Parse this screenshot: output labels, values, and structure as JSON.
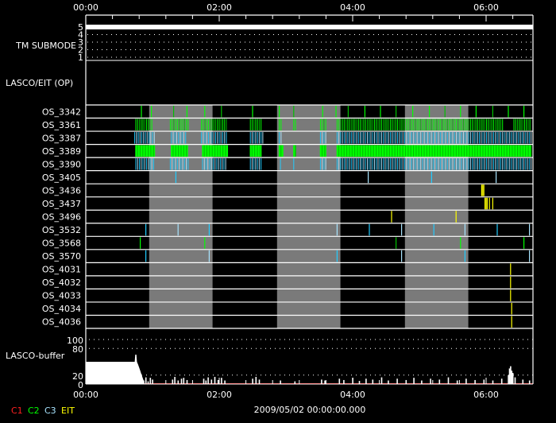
{
  "chart_data": {
    "type": "timeline",
    "title": "LASCO/EIT observation timeline",
    "time_unit": "minutes since 00:00",
    "xlim": [
      0,
      402
    ],
    "x_tick_labels": [
      "00:00",
      "02:00",
      "04:00",
      "06:00"
    ],
    "x_tick_minutes": [
      0,
      120,
      240,
      360
    ],
    "date_label": "2009/05/02 00:00:00.000",
    "colors": {
      "C1": "#ff2020",
      "C2": "#00ff00",
      "C3": "#22ccff",
      "C3b": "#a8e4ff",
      "EIT": "#ffff00",
      "gray": "#7a7a7a"
    },
    "legend": [
      {
        "label": "C1",
        "color": "#ff2020"
      },
      {
        "label": "C2",
        "color": "#00ff00"
      },
      {
        "label": "C3",
        "color": "#a8e4ff"
      },
      {
        "label": "EIT",
        "color": "#ffff00"
      }
    ],
    "tm_submode": {
      "label": "TM SUBMODE",
      "levels": [
        "5",
        "4",
        "3",
        "2",
        "1"
      ],
      "value": 5
    },
    "lasco_eit_op": {
      "label": "LASCO/EIT (OP)"
    },
    "gray_intervals": [
      [
        57,
        114
      ],
      [
        172,
        229
      ],
      [
        287,
        344
      ]
    ],
    "rows": [
      {
        "label": "OS_3342",
        "color": "C2",
        "events": [
          50,
          59,
          79,
          91,
          107,
          122,
          150,
          174,
          187,
          213,
          225,
          236,
          251,
          265,
          279,
          294,
          309,
          323,
          337,
          351,
          366,
          380,
          394
        ]
      },
      {
        "label": "OS_3361",
        "color": "C2",
        "clusters": [
          [
            45,
            61
          ],
          [
            76,
            92
          ],
          [
            104,
            127
          ],
          [
            148,
            158
          ],
          [
            174,
            176
          ],
          [
            187,
            189
          ],
          [
            211,
            216
          ],
          [
            226,
            375
          ],
          [
            385,
            401
          ]
        ]
      },
      {
        "label": "OS_3387",
        "color": "C3",
        "clusters": [
          [
            44,
            62
          ],
          [
            77,
            91
          ],
          [
            104,
            127
          ],
          [
            148,
            160
          ],
          [
            174,
            177
          ],
          [
            211,
            216
          ],
          [
            226,
            401
          ]
        ]
      },
      {
        "label": "OS_3389",
        "color": "C2",
        "dense": true,
        "clusters": [
          [
            45,
            62
          ],
          [
            77,
            92
          ],
          [
            105,
            128
          ],
          [
            148,
            158
          ],
          [
            174,
            178
          ],
          [
            187,
            189
          ],
          [
            211,
            216
          ],
          [
            226,
            401
          ]
        ]
      },
      {
        "label": "OS_3390",
        "color": "C3",
        "clusters": [
          [
            45,
            62
          ],
          [
            76,
            92
          ],
          [
            105,
            127
          ],
          [
            148,
            159
          ],
          [
            175,
            176
          ],
          [
            187,
            188
          ],
          [
            211,
            216
          ],
          [
            226,
            401
          ]
        ]
      },
      {
        "label": "OS_3405",
        "color": "C3",
        "events": [
          81,
          254,
          311,
          369
        ]
      },
      {
        "label": "OS_3436",
        "color": "EIT",
        "events": [
          356,
          357,
          358
        ]
      },
      {
        "label": "OS_3437",
        "color": "EIT",
        "events": [
          359,
          360,
          361,
          363,
          366
        ]
      },
      {
        "label": "OS_3496",
        "color": "EIT",
        "events": [
          275,
          333
        ]
      },
      {
        "label": "OS_3532",
        "color": "C3",
        "events": [
          54,
          83,
          111,
          226,
          255,
          284,
          313,
          341,
          370,
          399
        ]
      },
      {
        "label": "OS_3568",
        "color": "C2",
        "events": [
          49,
          107,
          279,
          337,
          394
        ]
      },
      {
        "label": "OS_3570",
        "color": "C3",
        "events": [
          54,
          111,
          226,
          284,
          341,
          399
        ]
      },
      {
        "label": "OS_4031",
        "color": "EIT",
        "events": [
          382
        ]
      },
      {
        "label": "OS_4032",
        "color": "EIT",
        "events": [
          382
        ]
      },
      {
        "label": "OS_4033",
        "color": "EIT",
        "events": [
          382
        ]
      },
      {
        "label": "OS_4034",
        "color": "EIT",
        "events": [
          383
        ]
      },
      {
        "label": "OS_4036",
        "color": "EIT",
        "events": [
          383
        ]
      }
    ],
    "buffer": {
      "label": "LASCO-buffer",
      "ylim": [
        0,
        100
      ],
      "y_tick_labels": [
        "100",
        "80",
        "20",
        "0"
      ],
      "y_ticks": [
        100,
        80,
        20,
        0
      ],
      "profile": [
        [
          0,
          50
        ],
        [
          44,
          50
        ],
        [
          44.5,
          66
        ],
        [
          45.5,
          66
        ],
        [
          46,
          50
        ],
        [
          47,
          44
        ],
        [
          48,
          37
        ],
        [
          49,
          30
        ],
        [
          50,
          22
        ],
        [
          51,
          15
        ],
        [
          52,
          8
        ],
        [
          53,
          0
        ]
      ],
      "spikes": [
        [
          50,
          12
        ],
        [
          52,
          8
        ],
        [
          54,
          15
        ],
        [
          56,
          6
        ],
        [
          58,
          14
        ],
        [
          60,
          10
        ],
        [
          78,
          10
        ],
        [
          80,
          16
        ],
        [
          83,
          8
        ],
        [
          86,
          12
        ],
        [
          88,
          14
        ],
        [
          91,
          9
        ],
        [
          106,
          12
        ],
        [
          108,
          8
        ],
        [
          110,
          15
        ],
        [
          113,
          10
        ],
        [
          116,
          16
        ],
        [
          119,
          9
        ],
        [
          122,
          14
        ],
        [
          125,
          8
        ],
        [
          150,
          12
        ],
        [
          153,
          16
        ],
        [
          156,
          10
        ],
        [
          175,
          8
        ],
        [
          188,
          6
        ],
        [
          212,
          10
        ],
        [
          215,
          8
        ],
        [
          228,
          12
        ],
        [
          232,
          9
        ],
        [
          240,
          14
        ],
        [
          246,
          7
        ],
        [
          252,
          12
        ],
        [
          258,
          10
        ],
        [
          266,
          15
        ],
        [
          272,
          8
        ],
        [
          280,
          12
        ],
        [
          288,
          9
        ],
        [
          295,
          14
        ],
        [
          302,
          8
        ],
        [
          310,
          12
        ],
        [
          318,
          10
        ],
        [
          326,
          15
        ],
        [
          334,
          8
        ],
        [
          342,
          12
        ],
        [
          350,
          9
        ],
        [
          358,
          10
        ],
        [
          366,
          8
        ],
        [
          374,
          12
        ],
        [
          380,
          20
        ],
        [
          381,
          35
        ],
        [
          382,
          40
        ],
        [
          383,
          30
        ],
        [
          384,
          25
        ],
        [
          386,
          15
        ],
        [
          393,
          10
        ],
        [
          399,
          8
        ]
      ],
      "baseline_from": 53
    }
  }
}
